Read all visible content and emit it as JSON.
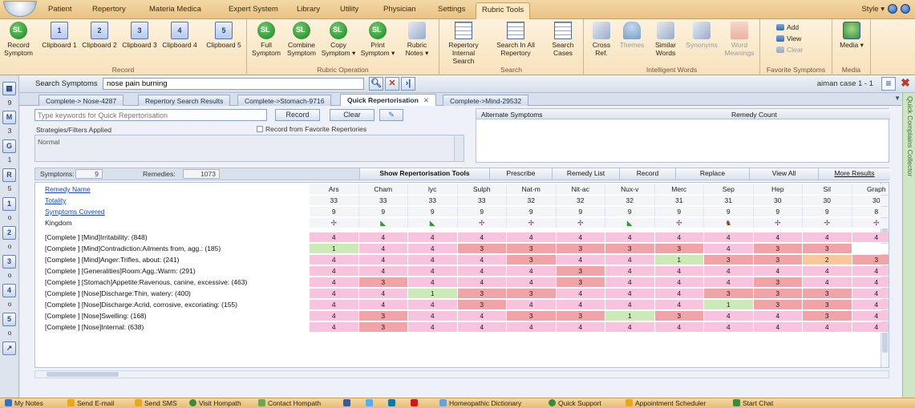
{
  "menu": {
    "items": [
      "Patient",
      "Repertory",
      "Materia Medica",
      "Expert System",
      "Library",
      "Utility",
      "Physician",
      "Settings",
      "Rubric Tools"
    ],
    "active": "Rubric Tools",
    "style_label": "Style"
  },
  "ribbon": {
    "groups": {
      "record": "Record",
      "rubric_operation": "Rubric Operation",
      "search": "Search",
      "intelligent_words": "Intelligent Words",
      "favorite_symptoms": "Favorite Symptoms",
      "media": "Media"
    },
    "record": {
      "record_symptom": "Record Symptom",
      "clip1": "Clipboard 1",
      "clip2": "Clipboard 2",
      "clip3": "Clipboard 3",
      "clip4": "Clipboard 4",
      "clip5": "Clipboard 5"
    },
    "rubric_operation": {
      "full": "Full Symptom",
      "combine": "Combine Symptom",
      "copy": "Copy Symptom ▾",
      "print": "Print Symptom ▾",
      "notes": "Rubric Notes ▾"
    },
    "search": {
      "repertory_internal": "Repertory Internal Search",
      "search_all": "Search In All Repertory",
      "search_cases": "Search Cases"
    },
    "intelligent": {
      "cross_ref": "Cross Ref.",
      "themes": "Themes",
      "similar_words": "Similar Words",
      "synonyms": "Synonyms",
      "word_meanings": "Word Meanings"
    },
    "favorites": {
      "add": "Add",
      "view": "View",
      "clear": "Clear"
    },
    "media": {
      "label": "Media ▾"
    }
  },
  "search": {
    "label": "Search Symptoms",
    "value": "nose pain burning",
    "case_label": "aiman case 1 - 1"
  },
  "doc_tabs": [
    "Complete-> Nose-4287",
    "Repertory Search Results",
    "Complete->Stomach-9716",
    "Quick Repertorisation",
    "Complete->Mind-29532"
  ],
  "active_tab": "Quick Repertorisation",
  "panel": {
    "keyword_placeholder": "Type keywords for Quick Repertorisation",
    "record_btn": "Record",
    "clear_btn": "Clear",
    "strategies_label": "Strategies/Filters Applied",
    "record_fav_label": "Record from Favorite Repertories",
    "filter_value": "Normal",
    "alt_symptoms": "Alternate Symptoms",
    "remedy_count": "Remedy Count"
  },
  "counts": {
    "symptoms_label": "Symptoms:",
    "symptoms": "9",
    "remedies_label": "Remedies:",
    "remedies": "1073"
  },
  "actions": [
    "Show Repertorisation Tools",
    "Prescribe",
    "Remedy List",
    "Record",
    "Replace",
    "View All",
    "More Results"
  ],
  "grid": {
    "remedy_name_label": "Remedy Name",
    "totality_label": "Totality",
    "symptoms_covered_label": "Symptoms Covered",
    "kingdom_label": "Kingdom",
    "remedies": [
      "Ars",
      "Cham",
      "lyc",
      "Sulph",
      "Nat-m",
      "Nit-ac",
      "Nux-v",
      "Merc",
      "Sep",
      "Hep",
      "Sil",
      "Graph"
    ],
    "totality": [
      "33",
      "33",
      "33",
      "33",
      "32",
      "32",
      "32",
      "31",
      "31",
      "30",
      "30",
      "30"
    ],
    "covered": [
      "9",
      "9",
      "9",
      "9",
      "9",
      "9",
      "9",
      "9",
      "9",
      "9",
      "9",
      "8"
    ],
    "kingdom": [
      "mineral",
      "plant",
      "plant",
      "mineral",
      "mineral",
      "mineral",
      "plant",
      "mineral",
      "animal",
      "mineral",
      "mineral",
      "mineral"
    ],
    "rubrics": [
      {
        "name": "[Complete ] [Mind]Irritability: (848)",
        "values": [
          "4",
          "4",
          "4",
          "4",
          "4",
          "4",
          "4",
          "4",
          "4",
          "4",
          "4",
          "4"
        ],
        "colors": [
          "pink",
          "pink",
          "pink",
          "pink",
          "pink",
          "pink",
          "pink",
          "pink",
          "pink",
          "pink",
          "pink",
          "pink"
        ]
      },
      {
        "name": "[Complete ] [Mind]Contradiction:Ailments from, agg.: (185)",
        "values": [
          "1",
          "4",
          "4",
          "3",
          "3",
          "3",
          "3",
          "3",
          "4",
          "3",
          "3",
          ""
        ],
        "colors": [
          "green",
          "pink",
          "pink",
          "red",
          "red",
          "red",
          "red",
          "red",
          "pink",
          "red",
          "red",
          "white"
        ]
      },
      {
        "name": "[Complete ] [Mind]Anger:Trifles, about: (241)",
        "values": [
          "4",
          "4",
          "4",
          "4",
          "3",
          "4",
          "4",
          "1",
          "3",
          "3",
          "2",
          "3"
        ],
        "colors": [
          "pink",
          "pink",
          "pink",
          "pink",
          "red",
          "pink",
          "pink",
          "green",
          "red",
          "red",
          "orange",
          "red"
        ]
      },
      {
        "name": "[Complete ] [Generalities]Room:Agg.:Warm: (291)",
        "values": [
          "4",
          "4",
          "4",
          "4",
          "4",
          "3",
          "4",
          "4",
          "4",
          "4",
          "4",
          "4"
        ],
        "colors": [
          "pink",
          "pink",
          "pink",
          "pink",
          "pink",
          "red",
          "pink",
          "pink",
          "pink",
          "pink",
          "pink",
          "pink"
        ]
      },
      {
        "name": "[Complete ] [Stomach]Appetite:Ravenous, canine, excessive: (463)",
        "values": [
          "4",
          "3",
          "4",
          "4",
          "4",
          "3",
          "4",
          "4",
          "4",
          "3",
          "4",
          "4"
        ],
        "colors": [
          "pink",
          "red",
          "pink",
          "pink",
          "pink",
          "red",
          "pink",
          "pink",
          "pink",
          "red",
          "pink",
          "pink"
        ]
      },
      {
        "name": "[Complete ] [Nose]Discharge:Thin, watery: (400)",
        "values": [
          "4",
          "4",
          "1",
          "3",
          "3",
          "4",
          "4",
          "4",
          "3",
          "3",
          "3",
          "4"
        ],
        "colors": [
          "pink",
          "pink",
          "green",
          "red",
          "red",
          "pink",
          "pink",
          "pink",
          "red",
          "red",
          "red",
          "pink"
        ]
      },
      {
        "name": "[Complete ] [Nose]Discharge:Acrid, corrosive, excoriating: (155)",
        "values": [
          "4",
          "4",
          "4",
          "3",
          "4",
          "4",
          "4",
          "4",
          "1",
          "3",
          "3",
          "4"
        ],
        "colors": [
          "pink",
          "pink",
          "pink",
          "red",
          "pink",
          "pink",
          "pink",
          "pink",
          "green",
          "red",
          "red",
          "pink"
        ]
      },
      {
        "name": "[Complete ] [Nose]Swelling: (168)",
        "values": [
          "4",
          "3",
          "4",
          "4",
          "3",
          "3",
          "1",
          "3",
          "4",
          "4",
          "3",
          "4"
        ],
        "colors": [
          "pink",
          "red",
          "pink",
          "pink",
          "red",
          "red",
          "green",
          "red",
          "pink",
          "pink",
          "red",
          "pink"
        ]
      },
      {
        "name": "[Complete ] [Nose]Internal: (638)",
        "values": [
          "4",
          "3",
          "4",
          "4",
          "4",
          "4",
          "4",
          "4",
          "4",
          "4",
          "4",
          "4"
        ],
        "colors": [
          "pink",
          "red",
          "pink",
          "pink",
          "pink",
          "pink",
          "pink",
          "pink",
          "pink",
          "pink",
          "pink",
          "pink"
        ]
      }
    ]
  },
  "rightbar_text": "Quick Complains Collector",
  "leftbar": {
    "labels": [
      "9",
      "3",
      "1",
      "o",
      "5",
      "o",
      "o",
      "o",
      "o",
      "o"
    ]
  },
  "bottom": [
    "My Notes",
    "Send E-mail",
    "Send SMS",
    "Visit Hompath",
    "Contact Hompath",
    "Homeopathic Dictionary",
    "Quick Support",
    "Appointment Scheduler",
    "Start Chat"
  ],
  "colors": {
    "pink": "#f7c3de",
    "red": "#f1a4a7",
    "green": "#cbeab7",
    "orange": "#f9c79a",
    "white": "#ffffff"
  }
}
